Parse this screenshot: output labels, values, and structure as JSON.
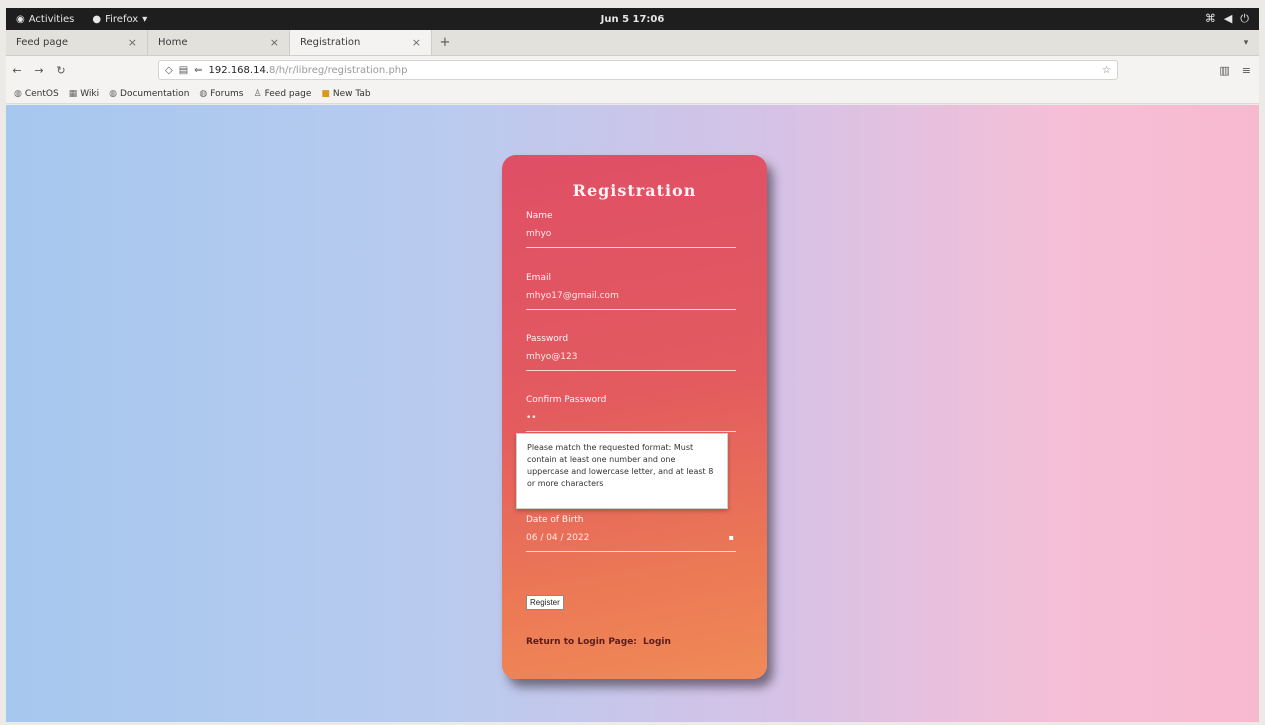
{
  "system_bar": {
    "activities": "Activities",
    "app_menu": "Firefox",
    "clock": "Jun 5 17:06",
    "tray": [
      "network",
      "volume",
      "power"
    ]
  },
  "browser": {
    "tabs": [
      {
        "label": "Feed page",
        "active": false
      },
      {
        "label": "Home",
        "active": false
      },
      {
        "label": "Registration",
        "active": true
      }
    ],
    "url": {
      "host": "192.168.14.",
      "path": "8/h/r/libreg/registration.php"
    },
    "bookmarks": [
      {
        "label": "CentOS",
        "icon": "globe-icon"
      },
      {
        "label": "Wiki",
        "icon": "page-icon"
      },
      {
        "label": "Documentation",
        "icon": "globe-icon"
      },
      {
        "label": "Forums",
        "icon": "globe-icon"
      },
      {
        "label": "Feed page",
        "icon": "person-icon"
      },
      {
        "label": "New Tab",
        "icon": "folder-icon"
      }
    ]
  },
  "form": {
    "title": "Registration",
    "fields": [
      {
        "label": "Name",
        "value": "mhyo"
      },
      {
        "label": "Email",
        "value": "mhyo17@gmail.com"
      },
      {
        "label": "Password",
        "value": "mhyo@123"
      },
      {
        "label": "Confirm Password",
        "value": "••"
      }
    ],
    "tooltip": "Please match the requested format: Must contain at least one number and one uppercase and lowercase letter, and at least 8 or more characters",
    "dob": {
      "label": "Date of Birth",
      "value": "06 / 04 / 2022"
    },
    "register_label": "Register",
    "return_text": "Return to Login Page:",
    "login_link": "Login"
  }
}
